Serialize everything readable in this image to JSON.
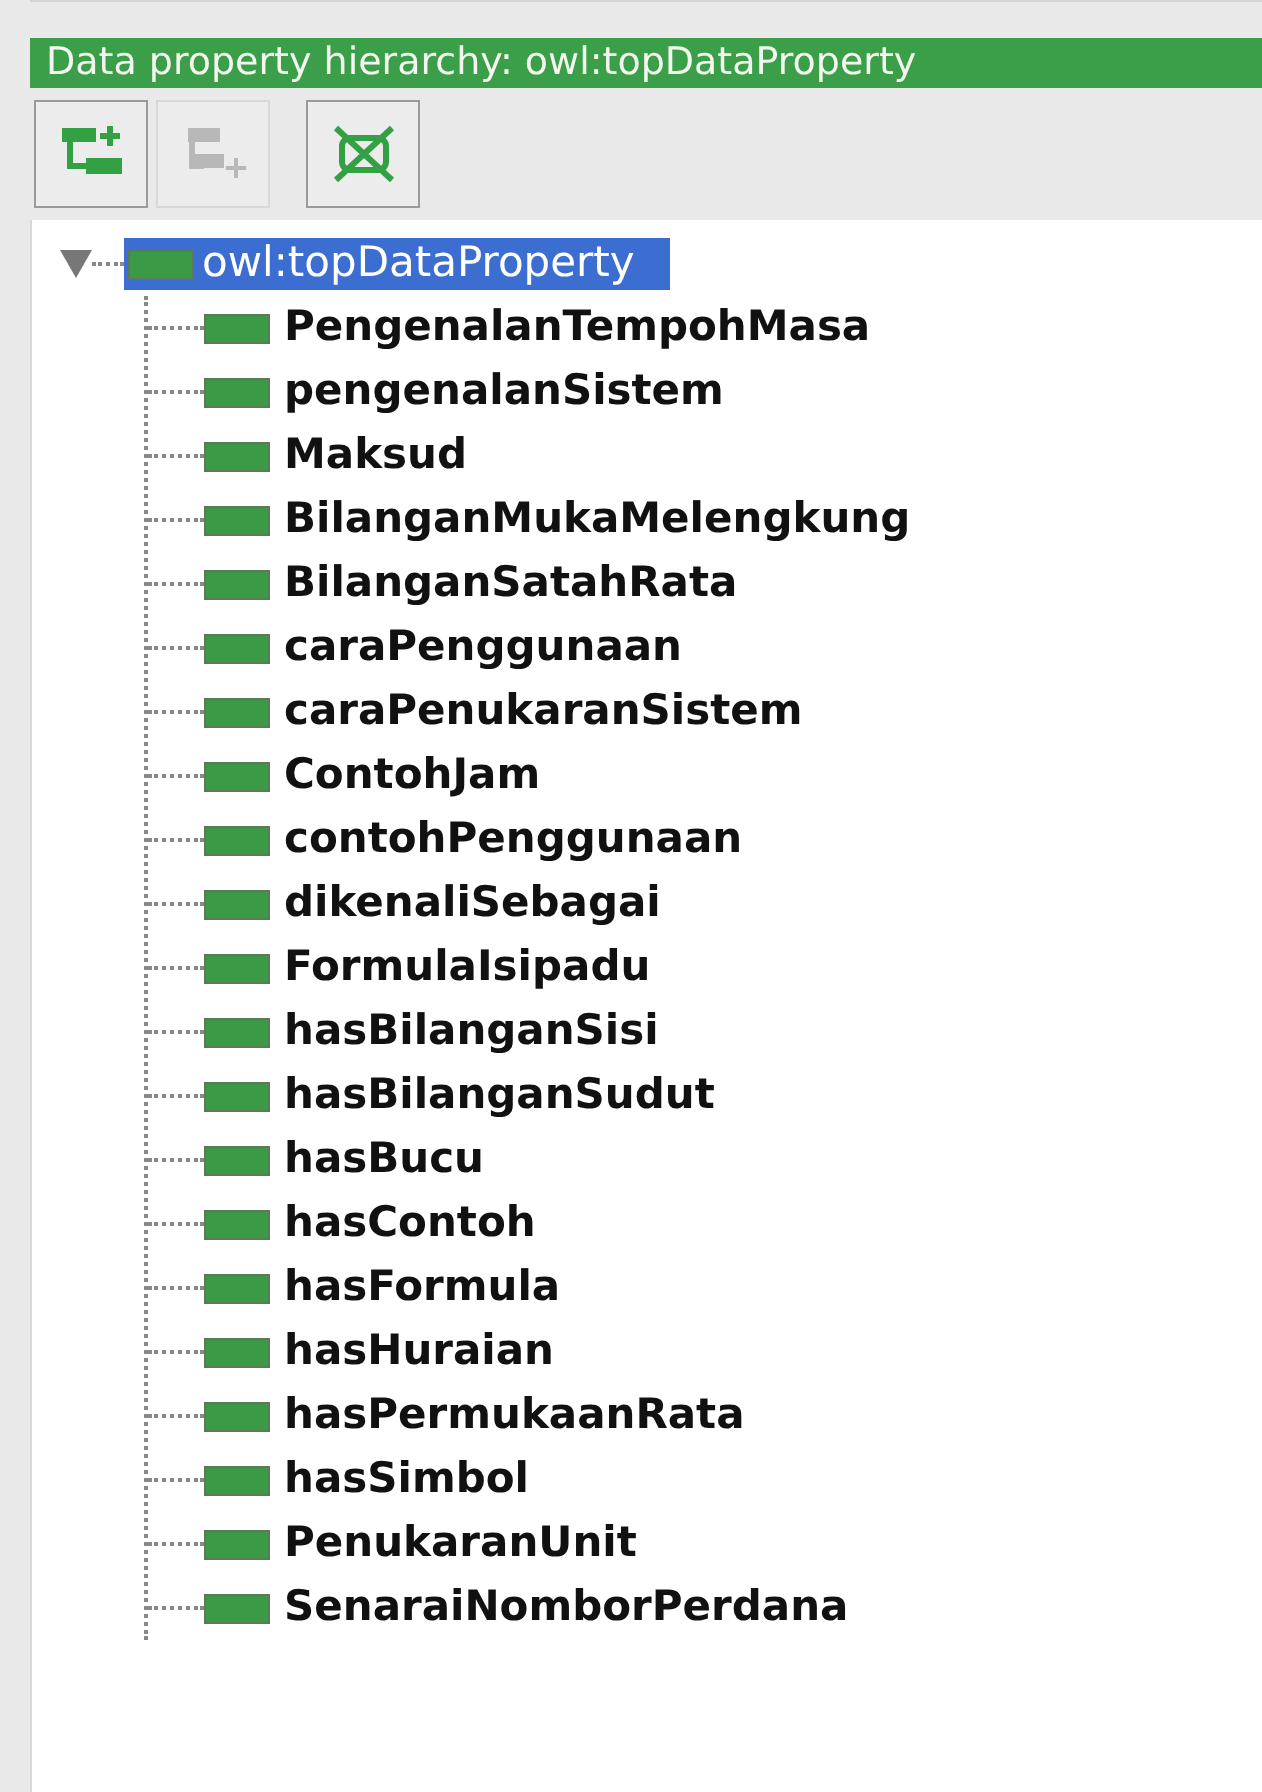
{
  "panel": {
    "title": "Data property hierarchy: owl:topDataProperty"
  },
  "toolbar": [
    {
      "kind": "add-sub",
      "disabled": false
    },
    {
      "kind": "add-sibling",
      "disabled": true
    },
    {
      "kind": "delete",
      "disabled": false
    }
  ],
  "tree": {
    "label": "owl:topDataProperty",
    "selected": true,
    "expanded": true,
    "children": [
      {
        "label": "PengenalanTempohMasa",
        "selected": false
      },
      {
        "label": "pengenalanSistem",
        "selected": false
      },
      {
        "label": "Maksud",
        "selected": false
      },
      {
        "label": "BilanganMukaMelengkung",
        "selected": false
      },
      {
        "label": "BilanganSatahRata",
        "selected": false
      },
      {
        "label": "caraPenggunaan",
        "selected": false
      },
      {
        "label": "caraPenukaranSistem",
        "selected": false
      },
      {
        "label": "ContohJam",
        "selected": false
      },
      {
        "label": "contohPenggunaan",
        "selected": false
      },
      {
        "label": "dikenaliSebagai",
        "selected": false
      },
      {
        "label": "FormulaIsipadu",
        "selected": false
      },
      {
        "label": "hasBilanganSisi",
        "selected": false
      },
      {
        "label": "hasBilanganSudut",
        "selected": false
      },
      {
        "label": "hasBucu",
        "selected": false
      },
      {
        "label": "hasContoh",
        "selected": false
      },
      {
        "label": "hasFormula",
        "selected": false
      },
      {
        "label": "hasHuraian",
        "selected": false
      },
      {
        "label": "hasPermukaanRata",
        "selected": false
      },
      {
        "label": "hasSimbol",
        "selected": false
      },
      {
        "label": "PenukaranUnit",
        "selected": false
      },
      {
        "label": "SenaraiNomborPerdana",
        "selected": false
      }
    ]
  }
}
